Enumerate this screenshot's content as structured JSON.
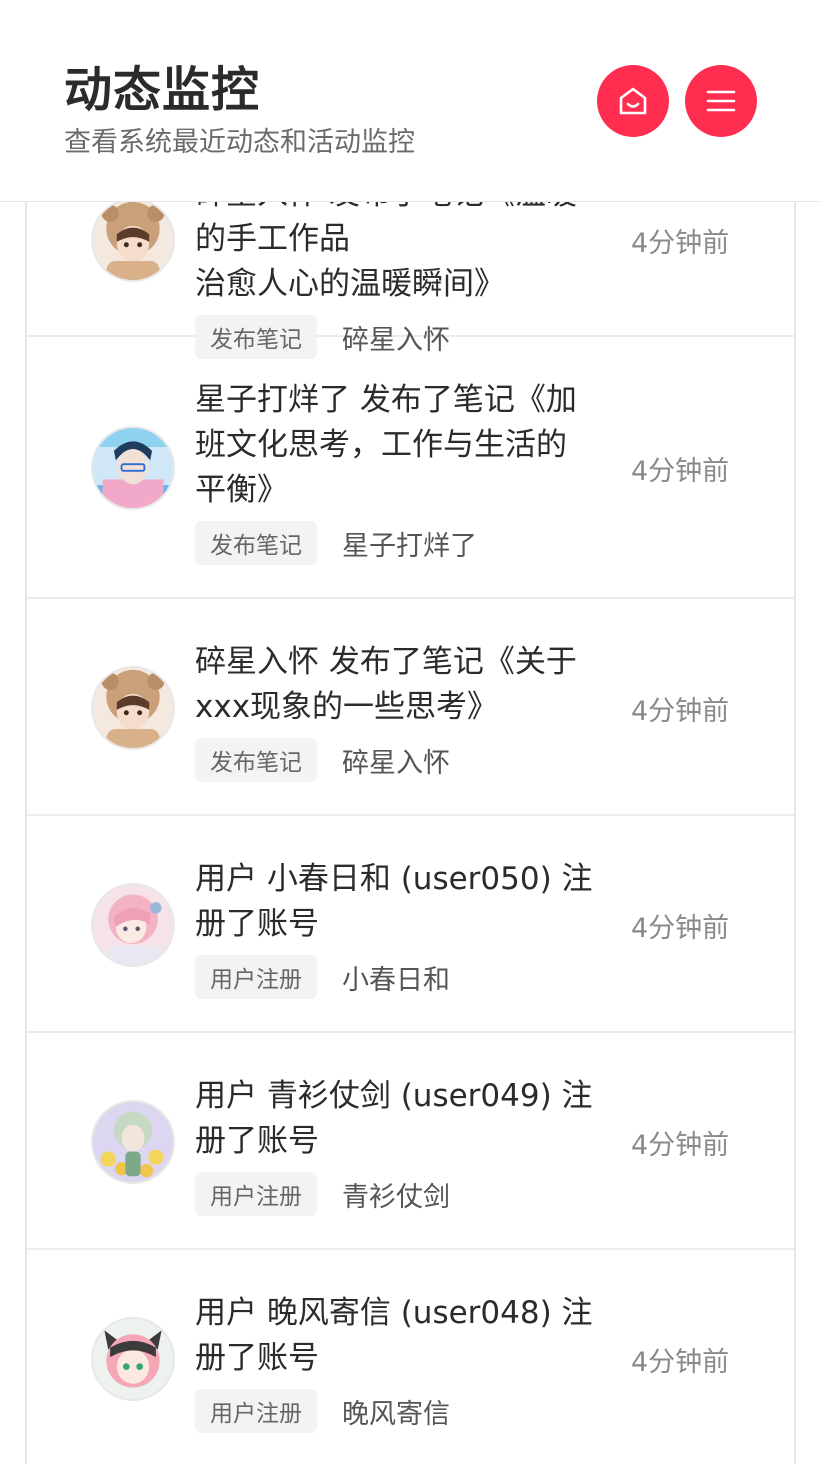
{
  "header": {
    "title": "动态监控",
    "subtitle": "查看系统最近动态和活动监控"
  },
  "icons": {
    "home": "home-smile-icon",
    "menu": "menu-icon"
  },
  "colors": {
    "accent": "#ff2d4f"
  },
  "activities": [
    {
      "lines": [
        "碎星入怀 发布了笔记《温暖的手工作品",
        "治愈人心的温暖瞬间》"
      ],
      "tag": "发布笔记",
      "user": "碎星入怀",
      "time": "4分钟前",
      "avatar": "girl-bear-hood-avatar"
    },
    {
      "lines": [
        "星子打烊了 发布了笔记《加",
        "班文化思考，工作与生活的",
        "平衡》"
      ],
      "tag": "发布笔记",
      "user": "星子打烊了",
      "time": "4分钟前",
      "avatar": "blue-hair-boy-avatar"
    },
    {
      "lines": [
        "碎星入怀 发布了笔记《关于",
        "xxx现象的一些思考》"
      ],
      "tag": "发布笔记",
      "user": "碎星入怀",
      "time": "4分钟前",
      "avatar": "girl-bear-hood-avatar"
    },
    {
      "lines": [
        "用户 小春日和 (user050) 注",
        "册了账号"
      ],
      "tag": "用户注册",
      "user": "小春日和",
      "time": "4分钟前",
      "avatar": "pink-hair-girl-avatar"
    },
    {
      "lines": [
        "用户 青衫仗剑 (user049) 注",
        "册了账号"
      ],
      "tag": "用户注册",
      "user": "青衫仗剑",
      "time": "4分钟前",
      "avatar": "flower-girl-avatar"
    },
    {
      "lines": [
        "用户 晚风寄信 (user048) 注",
        "册了账号"
      ],
      "tag": "用户注册",
      "user": "晚风寄信",
      "time": "4分钟前",
      "avatar": "cat-ear-girl-avatar"
    }
  ]
}
